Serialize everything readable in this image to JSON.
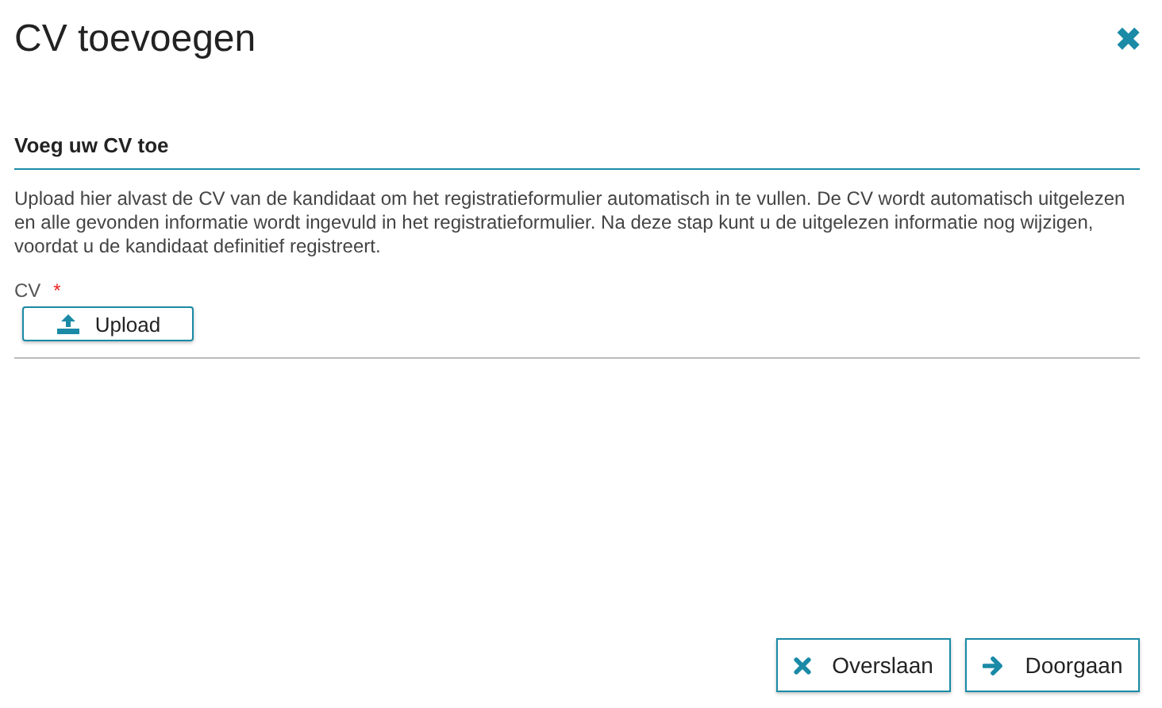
{
  "dialog": {
    "title": "CV toevoegen",
    "close_icon": "✖"
  },
  "section": {
    "heading": "Voeg uw CV toe",
    "description": "Upload hier alvast de CV van de kandidaat om het registratieformulier automatisch in te vullen. De CV wordt automatisch uitgelezen en alle gevonden informatie wordt ingevuld in het registratieformulier. Na deze stap kunt u de uitgelezen informatie nog wijzigen, voordat u de kandidaat definitief registreert."
  },
  "field": {
    "label": "CV",
    "required_mark": "*",
    "button": "Upload"
  },
  "footer_buttons": [
    {
      "kind": "skip",
      "label": "Overslaan"
    },
    {
      "kind": "next",
      "label": "Doorgaan"
    }
  ]
}
